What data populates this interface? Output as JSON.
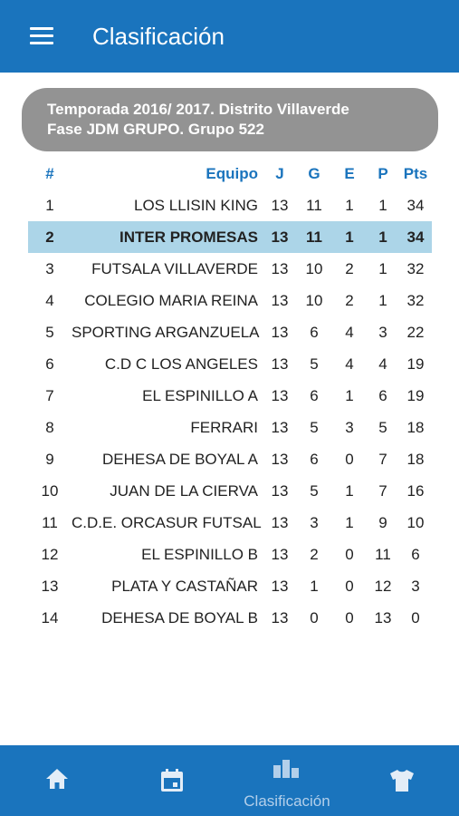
{
  "header": {
    "title": "Clasificación"
  },
  "season": {
    "line1": "Temporada 2016/ 2017. Distrito Villaverde",
    "line2": "Fase JDM GRUPO. Grupo 522"
  },
  "table": {
    "columns": {
      "pos": "#",
      "team": "Equipo",
      "j": "J",
      "g": "G",
      "e": "E",
      "p": "P",
      "pts": "Pts"
    },
    "rows": [
      {
        "pos": "1",
        "team": "LOS LLISIN KING",
        "j": "13",
        "g": "11",
        "e": "1",
        "p": "1",
        "pts": "34"
      },
      {
        "pos": "2",
        "team": "INTER PROMESAS",
        "j": "13",
        "g": "11",
        "e": "1",
        "p": "1",
        "pts": "34"
      },
      {
        "pos": "3",
        "team": "FUTSALA VILLAVERDE",
        "j": "13",
        "g": "10",
        "e": "2",
        "p": "1",
        "pts": "32"
      },
      {
        "pos": "4",
        "team": "COLEGIO MARIA REINA",
        "j": "13",
        "g": "10",
        "e": "2",
        "p": "1",
        "pts": "32"
      },
      {
        "pos": "5",
        "team": "SPORTING ARGANZUELA",
        "j": "13",
        "g": "6",
        "e": "4",
        "p": "3",
        "pts": "22"
      },
      {
        "pos": "6",
        "team": "C.D C LOS ANGELES",
        "j": "13",
        "g": "5",
        "e": "4",
        "p": "4",
        "pts": "19"
      },
      {
        "pos": "7",
        "team": "EL ESPINILLO A",
        "j": "13",
        "g": "6",
        "e": "1",
        "p": "6",
        "pts": "19"
      },
      {
        "pos": "8",
        "team": "FERRARI",
        "j": "13",
        "g": "5",
        "e": "3",
        "p": "5",
        "pts": "18"
      },
      {
        "pos": "9",
        "team": "DEHESA DE BOYAL A",
        "j": "13",
        "g": "6",
        "e": "0",
        "p": "7",
        "pts": "18"
      },
      {
        "pos": "10",
        "team": "JUAN DE LA CIERVA",
        "j": "13",
        "g": "5",
        "e": "1",
        "p": "7",
        "pts": "16"
      },
      {
        "pos": "11",
        "team": "C.D.E. ORCASUR FUTSAL",
        "j": "13",
        "g": "3",
        "e": "1",
        "p": "9",
        "pts": "10"
      },
      {
        "pos": "12",
        "team": "EL ESPINILLO B",
        "j": "13",
        "g": "2",
        "e": "0",
        "p": "11",
        "pts": "6"
      },
      {
        "pos": "13",
        "team": "PLATA Y CASTAÑAR",
        "j": "13",
        "g": "1",
        "e": "0",
        "p": "12",
        "pts": "3"
      },
      {
        "pos": "14",
        "team": "DEHESA DE BOYAL B",
        "j": "13",
        "g": "0",
        "e": "0",
        "p": "13",
        "pts": "0"
      }
    ]
  },
  "nav": {
    "items": [
      {
        "icon": "home-icon"
      },
      {
        "icon": "calendar-icon"
      },
      {
        "icon": "bar-chart-icon",
        "label": "Clasificación"
      },
      {
        "icon": "jersey-icon"
      }
    ]
  },
  "colors": {
    "primary": "#1a74bd",
    "season_box": "#939393",
    "highlight_row": "#acd5e8",
    "header_text": "#1a74bd"
  }
}
